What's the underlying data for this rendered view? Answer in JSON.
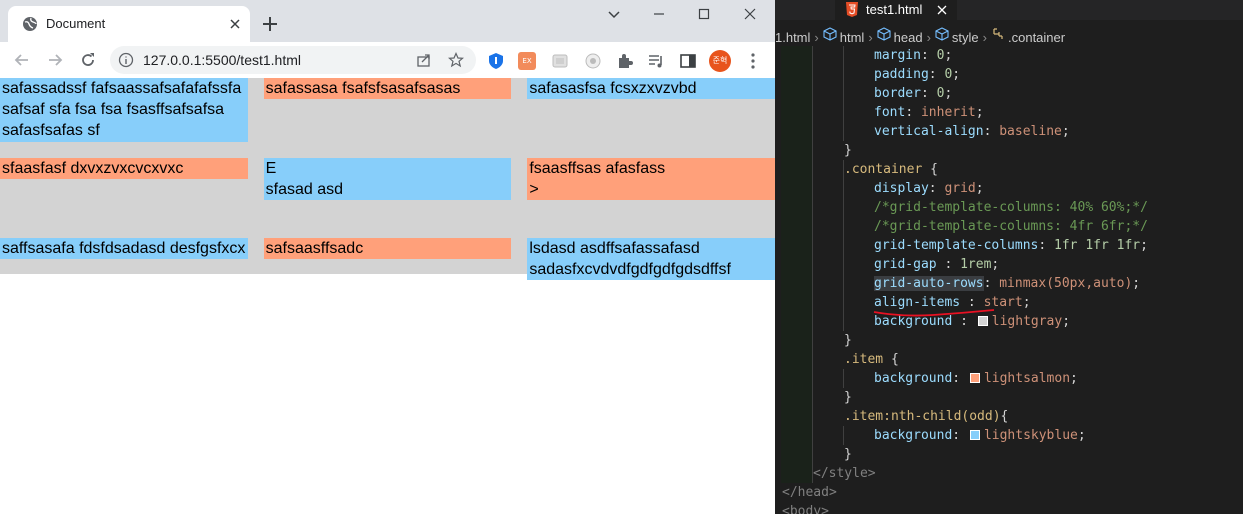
{
  "browser": {
    "tab_title": "Document",
    "url": "127.0.0.1:5500/test1.html",
    "profile_label": "준혁",
    "ext_badge": "EX"
  },
  "page": {
    "rows": [
      [
        {
          "text": "safassadssf fafsaassafsafafafssfa safsaf sfa fsa fsa fsasffsafsafsa safasfsafas sf",
          "color": "lightskyblue"
        },
        {
          "text": "safassasa fsafsfsasafsasas",
          "color": "lightsalmon"
        },
        {
          "text": "safasasfsa fcsxzxvzvbd",
          "color": "lightskyblue"
        }
      ],
      [
        {
          "text": "sfaasfasf dxvxzvxcvcxvxc",
          "color": "lightsalmon"
        },
        {
          "text": "E\nsfasad asd",
          "color": "lightskyblue"
        },
        {
          "text": "fsaasffsas afasfass\n>",
          "color": "lightsalmon"
        }
      ],
      [
        {
          "text": "saffsasafa fdsfdsadasd desfgsfxcx",
          "color": "lightskyblue"
        },
        {
          "text": "safsaasffsadc",
          "color": "lightsalmon"
        },
        {
          "text": "lsdasd asdffsafassafasd sadasfxcvdvdfgdfgdfgdsdffsf",
          "color": "lightskyblue"
        }
      ]
    ]
  },
  "editor": {
    "file_tab": "test1.html",
    "breadcrumbs": [
      "1.html",
      "html",
      "head",
      "style",
      ".container"
    ],
    "lines": [
      {
        "indent": 3,
        "prop": "margin",
        "value": "0"
      },
      {
        "indent": 3,
        "prop": "padding",
        "value": "0"
      },
      {
        "indent": 3,
        "prop": "border",
        "value": "0"
      },
      {
        "indent": 3,
        "prop": "font",
        "value": "inherit"
      },
      {
        "indent": 3,
        "prop": "vertical-align",
        "value": "baseline"
      },
      {
        "indent": 2,
        "text": "}"
      },
      {
        "indent": 2,
        "selector": ".container",
        "text": " {"
      },
      {
        "indent": 3,
        "prop": "display",
        "value": "grid"
      },
      {
        "indent": 3,
        "comment": "/*grid-template-columns: 40% 60%;*/"
      },
      {
        "indent": 3,
        "comment": "/*grid-template-columns: 4fr 6fr;*/"
      },
      {
        "indent": 3,
        "prop": "grid-template-columns",
        "value": "1fr 1fr 1fr"
      },
      {
        "indent": 3,
        "prop": "grid-gap",
        "sep": " : ",
        "value": "1rem"
      },
      {
        "indent": 3,
        "prop": "grid-auto-rows",
        "value": "minmax(50px,auto)",
        "highlight": true
      },
      {
        "indent": 3,
        "prop": "align-items",
        "sep": " : ",
        "value": "start",
        "underline": true
      },
      {
        "indent": 3,
        "prop": "background",
        "sep": " : ",
        "value": "lightgray",
        "swatch": "#d3d3d3"
      },
      {
        "indent": 2,
        "text": "}"
      },
      {
        "indent": 2,
        "selector": ".item",
        "text": " {"
      },
      {
        "indent": 3,
        "prop": "background",
        "value": "lightsalmon",
        "swatch": "#ffa07a"
      },
      {
        "indent": 2,
        "text": "}"
      },
      {
        "indent": 2,
        "selector": ".item:nth-child(odd)",
        "text": "{"
      },
      {
        "indent": 3,
        "prop": "background",
        "value": "lightskyblue",
        "swatch": "#87cefa"
      },
      {
        "indent": 2,
        "text": "}"
      },
      {
        "indent": 1,
        "tag": "</style>"
      },
      {
        "indent": 0,
        "tag": "</head>"
      },
      {
        "indent": 0,
        "tag": "<body>"
      }
    ]
  },
  "colors": {
    "lightgray": "#d3d3d3",
    "lightsalmon": "#ffa07a",
    "lightskyblue": "#87cefa",
    "editor_bg": "#1e1e1e"
  }
}
